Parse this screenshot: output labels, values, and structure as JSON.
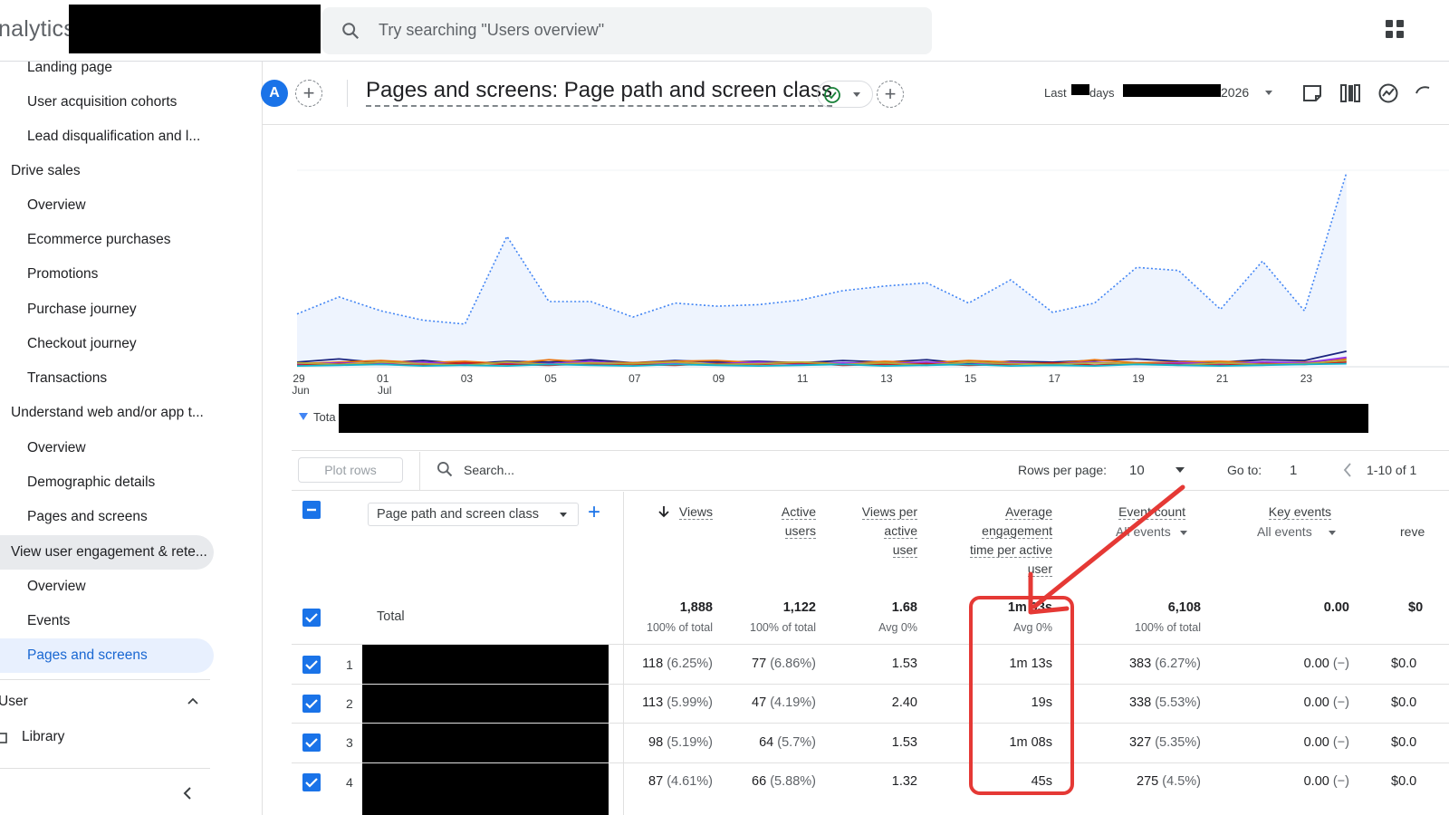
{
  "app": {
    "brand": "nalytics"
  },
  "search": {
    "placeholder": "Try searching \"Users overview\""
  },
  "sidebar": {
    "items": [
      {
        "label": "Landing page"
      },
      {
        "label": "User acquisition cohorts"
      },
      {
        "label": "Lead disqualification and l..."
      },
      {
        "label": "Drive sales"
      },
      {
        "label": "Overview"
      },
      {
        "label": "Ecommerce purchases"
      },
      {
        "label": "Promotions"
      },
      {
        "label": "Purchase journey"
      },
      {
        "label": "Checkout journey"
      },
      {
        "label": "Transactions"
      },
      {
        "label": "Understand web and/or app t..."
      },
      {
        "label": "Overview"
      },
      {
        "label": "Demographic details"
      },
      {
        "label": "Pages and screens"
      },
      {
        "label": "View user engagement & rete..."
      },
      {
        "label": "Overview"
      },
      {
        "label": "Events"
      },
      {
        "label": "Pages and screens"
      }
    ],
    "user_section": "User",
    "library": "Library",
    "collapse_icon": "chevron-left-icon"
  },
  "header": {
    "avatar": "A",
    "title": "Pages and screens: Page path and screen class",
    "date_prefix": "Last",
    "date_days": "days",
    "date_year": "2026",
    "status_icon": "check-circle-icon",
    "icons": [
      "notes-icon",
      "compare-icon",
      "insights-icon",
      "share-icon"
    ]
  },
  "chart_data": {
    "type": "line",
    "x": [
      "29 Jun",
      "30 Jun",
      "01 Jul",
      "02 Jul",
      "03 Jul",
      "04 Jul",
      "05 Jul",
      "06 Jul",
      "07 Jul",
      "08 Jul",
      "09 Jul",
      "10 Jul",
      "11 Jul",
      "12 Jul",
      "13 Jul",
      "14 Jul",
      "15 Jul",
      "16 Jul",
      "17 Jul",
      "18 Jul",
      "19 Jul",
      "20 Jul",
      "21 Jul",
      "22 Jul",
      "23 Jul",
      "24 Jul"
    ],
    "tick_labels": [
      {
        "day": "29",
        "month": "Jun"
      },
      {
        "day": "01",
        "month": "Jul"
      },
      {
        "day": "03",
        "month": ""
      },
      {
        "day": "05",
        "month": ""
      },
      {
        "day": "07",
        "month": ""
      },
      {
        "day": "09",
        "month": ""
      },
      {
        "day": "11",
        "month": ""
      },
      {
        "day": "13",
        "month": ""
      },
      {
        "day": "15",
        "month": ""
      },
      {
        "day": "17",
        "month": ""
      },
      {
        "day": "19",
        "month": ""
      },
      {
        "day": "21",
        "month": ""
      },
      {
        "day": "23",
        "month": ""
      }
    ],
    "legend_total": "Tota",
    "series": [
      {
        "color": "#4285f4",
        "style": "total-dotted-area",
        "values": [
          68,
          90,
          72,
          60,
          55,
          168,
          84,
          84,
          64,
          82,
          78,
          80,
          86,
          98,
          104,
          108,
          82,
          112,
          70,
          82,
          128,
          124,
          74,
          136,
          72,
          250
        ]
      },
      {
        "color": "#1a237e",
        "values": [
          6,
          10,
          5,
          8,
          4,
          7,
          6,
          9,
          5,
          8,
          6,
          7,
          5,
          8,
          6,
          9,
          4,
          7,
          6,
          8,
          10,
          7,
          6,
          9,
          8,
          20
        ]
      },
      {
        "color": "#e8710a",
        "values": [
          4,
          6,
          8,
          5,
          7,
          4,
          9,
          6,
          5,
          7,
          8,
          5,
          6,
          4,
          7,
          5,
          8,
          6,
          4,
          9,
          5,
          6,
          7,
          5,
          6,
          10
        ]
      },
      {
        "color": "#9334e6",
        "values": [
          3,
          5,
          4,
          6,
          3,
          5,
          4,
          7,
          3,
          5,
          4,
          6,
          3,
          5,
          4,
          6,
          3,
          5,
          4,
          6,
          3,
          5,
          4,
          6,
          5,
          12
        ]
      },
      {
        "color": "#c5221f",
        "values": [
          2,
          4,
          3,
          2,
          5,
          3,
          2,
          4,
          3,
          2,
          4,
          3,
          5,
          2,
          3,
          4,
          2,
          3,
          5,
          2,
          4,
          3,
          2,
          4,
          3,
          6
        ]
      },
      {
        "color": "#b6a83a",
        "values": [
          5,
          3,
          6,
          4,
          2,
          6,
          3,
          5,
          4,
          6,
          3,
          4,
          6,
          3,
          5,
          2,
          6,
          4,
          3,
          5,
          4,
          2,
          5,
          3,
          4,
          8
        ]
      },
      {
        "color": "#12b5cb",
        "values": [
          1,
          2,
          3,
          1,
          2,
          1,
          3,
          2,
          1,
          3,
          2,
          1,
          2,
          3,
          1,
          2,
          3,
          1,
          2,
          1,
          3,
          2,
          1,
          2,
          3,
          4
        ]
      }
    ],
    "ylim": [
      0,
      280
    ],
    "grid": true,
    "xlabel": "",
    "ylabel": ""
  },
  "toolbar": {
    "plot_rows": "Plot rows",
    "search_placeholder": "Search...",
    "rows_per_page_label": "Rows per page:",
    "rows_per_page": "10",
    "goto_label": "Go to:",
    "goto_value": "1",
    "pagination": "1-10 of 1"
  },
  "table": {
    "dimension": "Page path and screen class",
    "headers": {
      "views": "Views",
      "active_users": [
        "Active",
        "users"
      ],
      "views_per_user": [
        "Views per",
        "active",
        "user"
      ],
      "avg_engagement": [
        "Average",
        "engagement",
        "time per active",
        "user"
      ],
      "event_count": "Event count",
      "event_sub": "All events",
      "key_events": "Key events",
      "key_sub": "All events",
      "revenue": "reve"
    },
    "total": {
      "label": "Total",
      "views": "1,888",
      "views_sub": "100% of total",
      "active_users": "1,122",
      "active_users_sub": "100% of total",
      "views_per_user": "1.68",
      "views_per_user_sub": "Avg 0%",
      "avg_engagement": "1m 03s",
      "avg_engagement_sub": "Avg 0%",
      "event_count": "6,108",
      "event_count_sub": "100% of total",
      "key_events": "0.00",
      "revenue": "$0"
    },
    "rows": [
      {
        "n": "1",
        "views": "118",
        "views_pct": "(6.25%)",
        "users": "77",
        "users_pct": "(6.86%)",
        "vpu": "1.53",
        "eng": "1m 13s",
        "events": "383",
        "events_pct": "(6.27%)",
        "key": "0.00",
        "key_pct": "(−)",
        "rev": "$0.0"
      },
      {
        "n": "2",
        "views": "113",
        "views_pct": "(5.99%)",
        "users": "47",
        "users_pct": "(4.19%)",
        "vpu": "2.40",
        "eng": "19s",
        "events": "338",
        "events_pct": "(5.53%)",
        "key": "0.00",
        "key_pct": "(−)",
        "rev": "$0.0"
      },
      {
        "n": "3",
        "views": "98",
        "views_pct": "(5.19%)",
        "users": "64",
        "users_pct": "(5.7%)",
        "vpu": "1.53",
        "eng": "1m 08s",
        "events": "327",
        "events_pct": "(5.35%)",
        "key": "0.00",
        "key_pct": "(−)",
        "rev": "$0.0"
      },
      {
        "n": "4",
        "views": "87",
        "views_pct": "(4.61%)",
        "users": "66",
        "users_pct": "(5.88%)",
        "vpu": "1.32",
        "eng": "45s",
        "events": "275",
        "events_pct": "(4.5%)",
        "key": "0.00",
        "key_pct": "(−)",
        "rev": "$0.0"
      }
    ]
  },
  "annotation": {
    "color": "#e53935"
  }
}
